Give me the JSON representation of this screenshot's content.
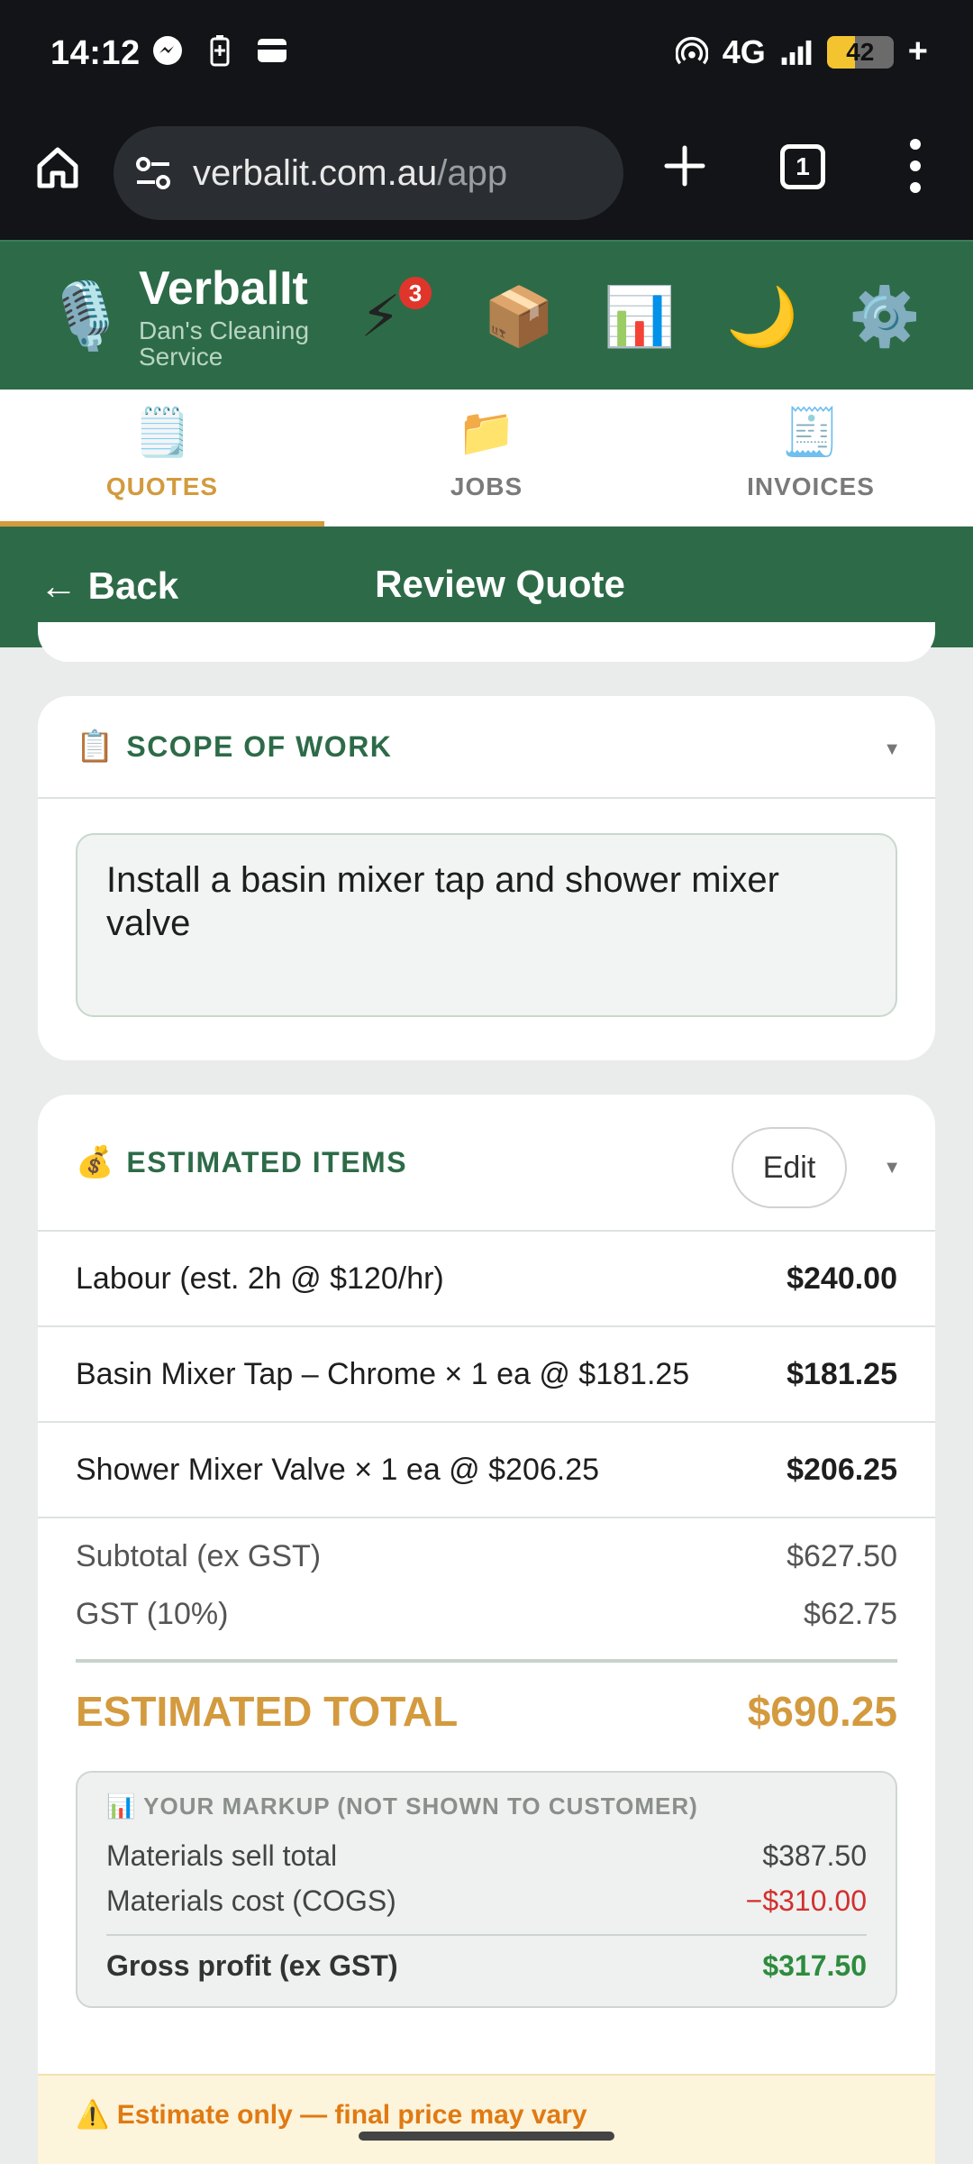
{
  "status_bar": {
    "time": "14:12",
    "network": "4G",
    "battery_level": "42",
    "battery_fraction": 0.42,
    "charging_symbol": "+",
    "icons": [
      "messenger-icon",
      "battery-saver-icon",
      "wallet-icon",
      "hotspot-icon",
      "signal-icon"
    ]
  },
  "browser": {
    "url_domain": "verbalit.com.au",
    "url_path": "/app",
    "tab_count": "1"
  },
  "app_header": {
    "title": "VerbalIt",
    "subtitle": "Dan's Cleaning Service",
    "notification_count": "3",
    "icons": [
      "microphone-icon",
      "lightning-icon",
      "package-icon",
      "chart-icon",
      "moon-icon",
      "gear-icon"
    ]
  },
  "tabs": [
    {
      "label": "QUOTES",
      "icon": "notepad-icon",
      "active": true
    },
    {
      "label": "JOBS",
      "icon": "folder-icon",
      "active": false
    },
    {
      "label": "INVOICES",
      "icon": "receipt-icon",
      "active": false
    }
  ],
  "sub_header": {
    "back_label": "← Back",
    "title": "Review Quote"
  },
  "scope": {
    "title": "SCOPE OF WORK",
    "text": "Install a basin mixer tap and shower mixer valve"
  },
  "items": {
    "title": "ESTIMATED ITEMS",
    "edit_label": "Edit",
    "rows": [
      {
        "description": "Labour (est. 2h @ $120/hr)",
        "amount": "$240.00"
      },
      {
        "description": "Basin Mixer Tap – Chrome × 1 ea @ $181.25",
        "amount": "$181.25"
      },
      {
        "description": "Shower Mixer Valve × 1 ea @ $206.25",
        "amount": "$206.25"
      }
    ],
    "subtotal_label": "Subtotal (ex GST)",
    "subtotal_value": "$627.50",
    "gst_label": "GST (10%)",
    "gst_value": "$62.75",
    "total_label": "ESTIMATED TOTAL",
    "total_value": "$690.25"
  },
  "markup": {
    "title": "YOUR MARKUP (NOT SHOWN TO CUSTOMER)",
    "materials_sell_label": "Materials sell total",
    "materials_sell_value": "$387.50",
    "materials_cost_label": "Materials cost (COGS)",
    "materials_cost_value": "−$310.00",
    "gross_profit_label": "Gross profit (ex GST)",
    "gross_profit_value": "$317.50"
  },
  "warning": {
    "text": "Estimate only — final price may vary"
  },
  "colors": {
    "brand_green": "#2d6b48",
    "accent_gold": "#d39a3e",
    "negative_red": "#d32f2f",
    "positive_green": "#2e8b3e",
    "warning_orange": "#e07a12"
  }
}
